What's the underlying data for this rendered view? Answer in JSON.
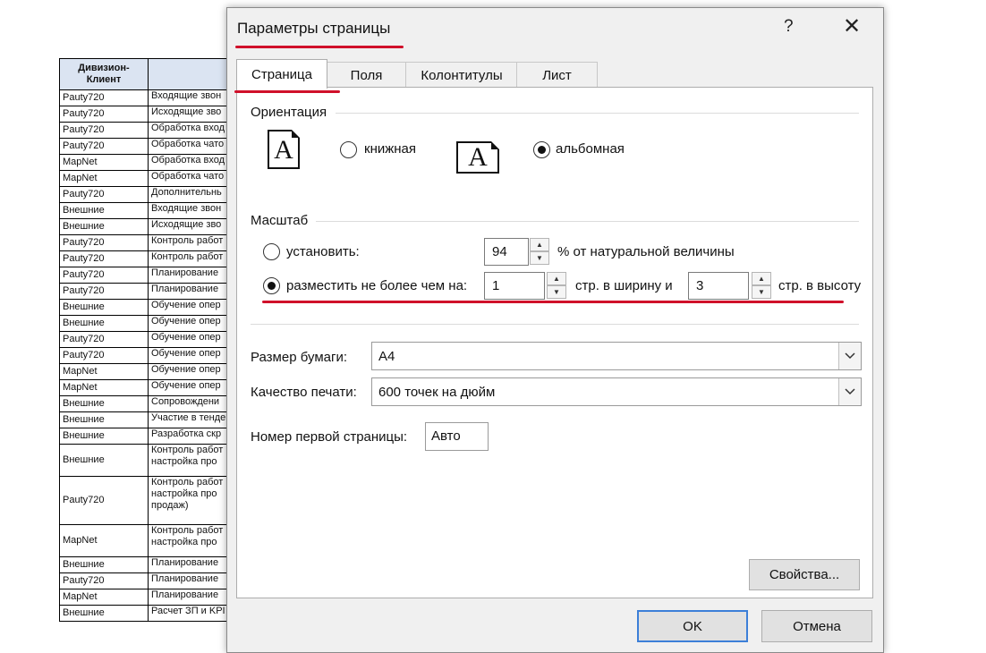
{
  "sheet": {
    "header": {
      "col1": "Дивизион-Клиент",
      "col2": ""
    },
    "rows": [
      {
        "a": "Pauty720",
        "b": "Входящие звон"
      },
      {
        "a": "Pauty720",
        "b": "Исходящие зво"
      },
      {
        "a": "Pauty720",
        "b": "Обработка вход"
      },
      {
        "a": "Pauty720",
        "b": "Обработка чато"
      },
      {
        "a": "MapNet",
        "b": "Обработка вход"
      },
      {
        "a": "MapNet",
        "b": "Обработка чато"
      },
      {
        "a": "Pauty720",
        "b": "Дополнительнь"
      },
      {
        "a": "Внешние",
        "b": "Входящие звон"
      },
      {
        "a": "Внешние",
        "b": "Исходящие зво"
      },
      {
        "a": "Pauty720",
        "b": "Контроль работ"
      },
      {
        "a": "Pauty720",
        "b": "Контроль работ"
      },
      {
        "a": "Pauty720",
        "b": "Планирование"
      },
      {
        "a": "Pauty720",
        "b": "Планирование"
      },
      {
        "a": "Внешние",
        "b": "Обучение опер"
      },
      {
        "a": "Внешние",
        "b": "Обучение опер"
      },
      {
        "a": "Pauty720",
        "b": "Обучение опер"
      },
      {
        "a": "Pauty720",
        "b": "Обучение опер"
      },
      {
        "a": "MapNet",
        "b": "Обучение опер"
      },
      {
        "a": "MapNet",
        "b": "Обучение опер"
      },
      {
        "a": "Внешние",
        "b": "Сопровождени"
      },
      {
        "a": "Внешние",
        "b": "Участие в тенде"
      },
      {
        "a": "Внешние",
        "b": "Разработка скр"
      },
      {
        "a": "Внешние",
        "b": "Контроль работ\nнастройка про"
      },
      {
        "a": "Pauty720",
        "b": "Контроль работ\nнастройка про\nпродаж)"
      },
      {
        "a": "MapNet",
        "b": "Контроль работ\nнастройка про"
      },
      {
        "a": "Внешние",
        "b": "Планирование"
      },
      {
        "a": "Pauty720",
        "b": "Планирование"
      },
      {
        "a": "MapNet",
        "b": "Планирование"
      },
      {
        "a": "Внешние",
        "b": "Расчет ЗП и KPI"
      }
    ]
  },
  "dialog": {
    "title": "Параметры страницы",
    "help": "?",
    "close": "✕",
    "tabs": [
      {
        "label": "Страница"
      },
      {
        "label": "Поля"
      },
      {
        "label": "Колонтитулы"
      },
      {
        "label": "Лист"
      }
    ],
    "orientation": {
      "group": "Ориентация",
      "icon_letter": "A",
      "portrait": "книжная",
      "landscape": "альбомная",
      "selected": "landscape"
    },
    "scale": {
      "group": "Масштаб",
      "adjust_label": "установить:",
      "adjust_value": "94",
      "adjust_suffix": "% от натуральной величины",
      "fit_label": "разместить не более чем на:",
      "fit_wide_value": "1",
      "fit_wide_suffix": "стр. в ширину и",
      "fit_tall_value": "3",
      "fit_tall_suffix": "стр. в высоту",
      "selected": "fit"
    },
    "paper_size": {
      "label": "Размер бумаги:",
      "value": "A4"
    },
    "print_quality": {
      "label": "Качество печати:",
      "value": "600 точек на дюйм"
    },
    "first_page": {
      "label": "Номер первой страницы:",
      "value": "Авто"
    },
    "properties_button": "Свойства...",
    "ok_button": "OK",
    "cancel_button": "Отмена",
    "colors": {
      "highlight": "#d0102a",
      "default_button_border": "#3c7fd8"
    }
  }
}
